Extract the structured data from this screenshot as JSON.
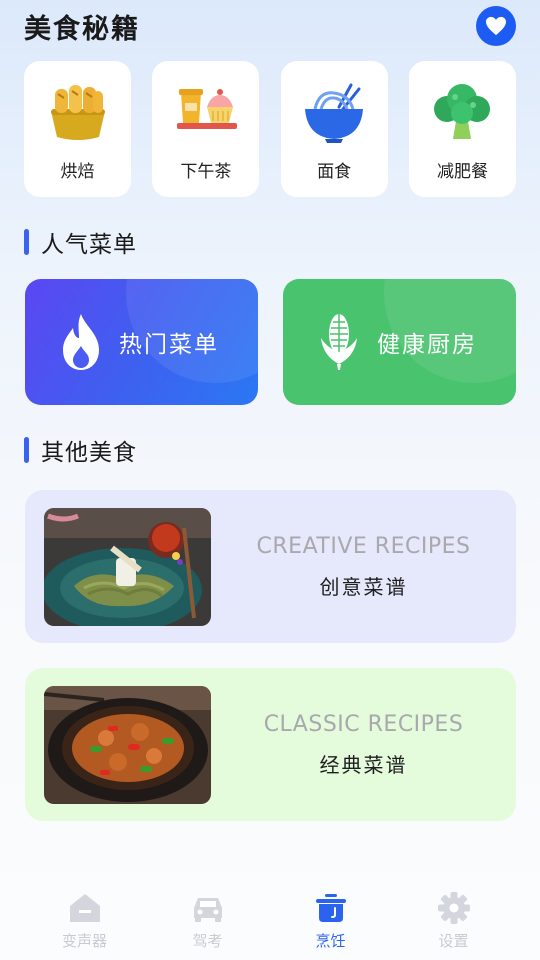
{
  "header": {
    "title": "美食秘籍",
    "favorite_icon": "heart-icon"
  },
  "categories": [
    {
      "label": "烘焙",
      "icon": "bread-icon"
    },
    {
      "label": "下午茶",
      "icon": "afternoon-tea-icon"
    },
    {
      "label": "面食",
      "icon": "noodle-bowl-icon"
    },
    {
      "label": "减肥餐",
      "icon": "broccoli-icon"
    }
  ],
  "popular": {
    "title": "人气菜单",
    "hot": {
      "label": "热门菜单",
      "icon": "flame-icon"
    },
    "health": {
      "label": "健康厨房",
      "icon": "corn-icon"
    }
  },
  "other": {
    "title": "其他美食",
    "creative": {
      "en": "CREATIVE RECIPES",
      "cn": "创意菜谱"
    },
    "classic": {
      "en": "CLASSIC RECIPES",
      "cn": "经典菜谱"
    }
  },
  "tabbar": [
    {
      "label": "变声器",
      "icon": "home-icon",
      "active": false
    },
    {
      "label": "驾考",
      "icon": "car-icon",
      "active": false
    },
    {
      "label": "烹饪",
      "icon": "cooking-pot-icon",
      "active": true
    },
    {
      "label": "设置",
      "icon": "gear-icon",
      "active": false
    }
  ],
  "colors": {
    "accent": "#2c63ee",
    "hot_card": "#4a56f1",
    "health_card": "#4ac36f"
  }
}
